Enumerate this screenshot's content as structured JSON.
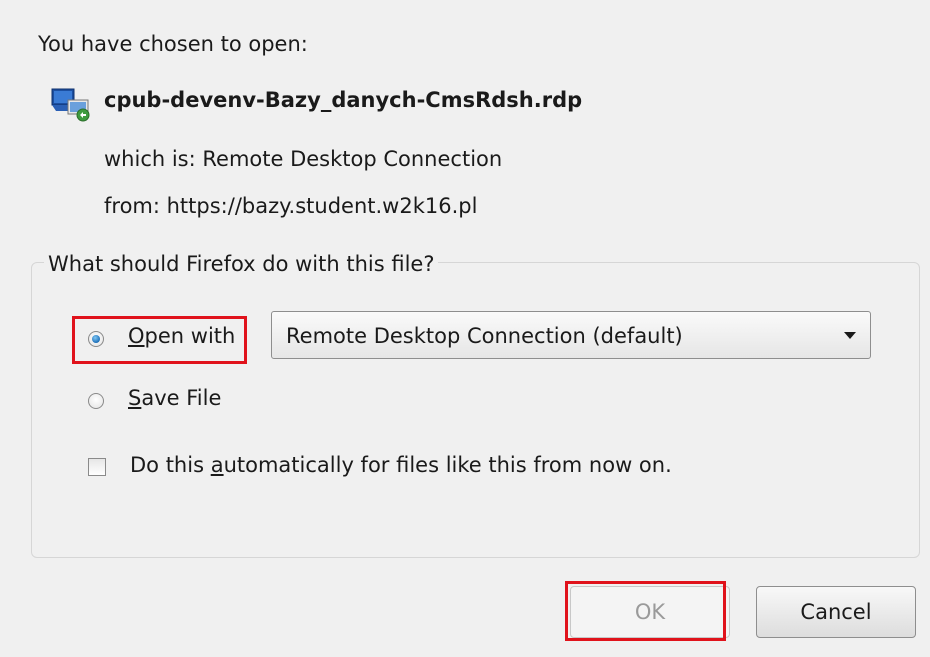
{
  "dialog": {
    "heading": "You have chosen to open:",
    "file_name": "cpub-devenv-Bazy_danych-CmsRdsh.rdp",
    "which_is": "which is: Remote Desktop Connection",
    "from": "from: https://bazy.student.w2k16.pl",
    "file_icon": "remote-desktop-file-icon"
  },
  "options": {
    "legend": "What should Firefox do with this file?",
    "open_with": {
      "access_key": "O",
      "rest": "pen with",
      "selected": true
    },
    "app_select": {
      "value": "Remote Desktop Connection (default)"
    },
    "save_file": {
      "access_key": "S",
      "rest": "ave File",
      "selected": false
    },
    "auto": {
      "before": "Do this ",
      "access_key": "a",
      "after": "utomatically for files like this from now on.",
      "checked": false
    }
  },
  "buttons": {
    "ok": "OK",
    "cancel": "Cancel"
  },
  "colors": {
    "highlight": "#e0121b",
    "radio_selected": "#1d6fb8",
    "dialog_bg": "#f0f0f0"
  }
}
